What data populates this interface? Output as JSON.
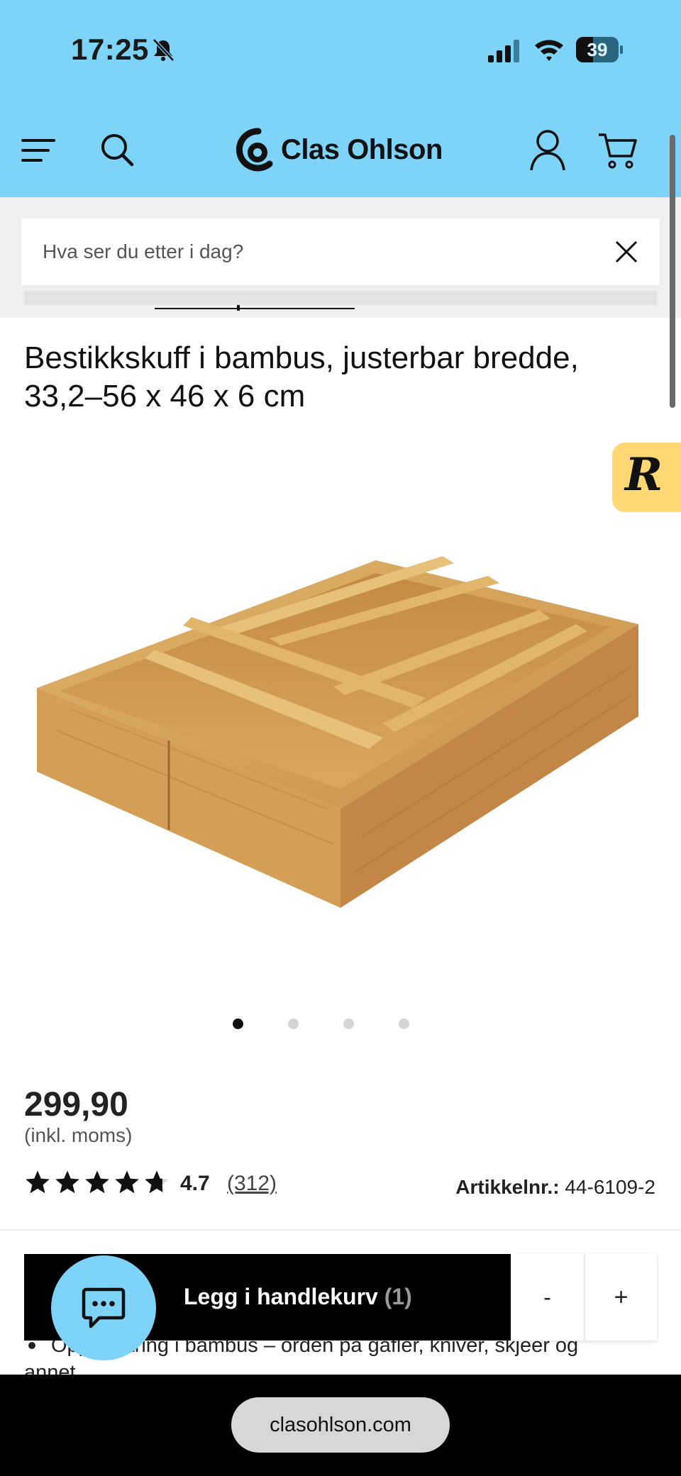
{
  "status_bar": {
    "time": "17:25",
    "battery": "39"
  },
  "header": {
    "brand": "Clas Ohlson",
    "icons": [
      "menu-icon",
      "search-icon",
      "account-icon",
      "cart-icon"
    ]
  },
  "search": {
    "placeholder": "Hva ser du etter i dag?"
  },
  "product": {
    "title": "Bestikkskuff i bambus, justerbar bredde, 33,2–56 x 46 x 6 cm",
    "image_count": 4,
    "active_image": 1,
    "price": "299,90",
    "vat_note": "(inkl. moms)",
    "rating": {
      "stars": 4.7,
      "value": "4.7",
      "count": "(312)"
    },
    "sku_label": "Artikkelnr.:",
    "sku": "44-6109-2",
    "bullet": "Oppbevaring i bambus – orden på gafler, kniver, skjeer og annet"
  },
  "cart_bar": {
    "label": "Legg i handlekurv",
    "qty": "(1)",
    "minus": "-",
    "plus": "+"
  },
  "badge": {
    "letter": "R"
  },
  "browser": {
    "url": "clasohlson.com"
  },
  "colors": {
    "header_bg": "#7dd3f8",
    "badge_bg": "#ffd873",
    "cart_button": "#000000"
  }
}
